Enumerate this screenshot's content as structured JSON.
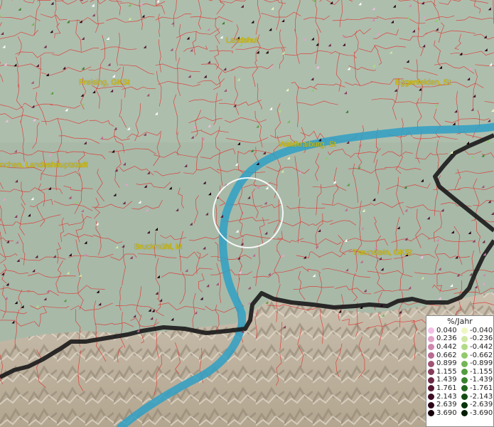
{
  "places": [
    {
      "name": "Landshut"
    },
    {
      "name": "Freising, GKSt"
    },
    {
      "name": "Eggenfelden, St"
    },
    {
      "name": "Waldkraiburg, St"
    },
    {
      "name": "nchen, Landeshauptstadt"
    },
    {
      "name": "Bruckmühl, M"
    },
    {
      "name": "Traunstein, GKSt"
    }
  ],
  "legend": {
    "title": "%/Jahr",
    "positive": [
      {
        "value": "0.040",
        "color": "#f3bfe6"
      },
      {
        "value": "0.236",
        "color": "#e3a3c9"
      },
      {
        "value": "0.442",
        "color": "#cf86ad"
      },
      {
        "value": "0.662",
        "color": "#b96a90"
      },
      {
        "value": "0.899",
        "color": "#a05373"
      },
      {
        "value": "1.155",
        "color": "#873c5b"
      },
      {
        "value": "1.439",
        "color": "#6d2846"
      },
      {
        "value": "1.761",
        "color": "#561734"
      },
      {
        "value": "2.143",
        "color": "#3f0b24"
      },
      {
        "value": "2.639",
        "color": "#2a0416"
      },
      {
        "value": "3.690",
        "color": "#170009"
      }
    ],
    "negative": [
      {
        "value": "-0.040",
        "color": "#eef7c0"
      },
      {
        "value": "-0.236",
        "color": "#cfe9a1"
      },
      {
        "value": "-0.442",
        "color": "#b1db86"
      },
      {
        "value": "-0.662",
        "color": "#93c96c"
      },
      {
        "value": "-0.899",
        "color": "#74b555"
      },
      {
        "value": "-1.155",
        "color": "#559c40"
      },
      {
        "value": "-1.439",
        "color": "#3a812d"
      },
      {
        "value": "-1.761",
        "color": "#23661e"
      },
      {
        "value": "-2.143",
        "color": "#134c12"
      },
      {
        "value": "-2.639",
        "color": "#07330a"
      },
      {
        "value": "-3.690",
        "color": "#021d04"
      }
    ]
  },
  "colors": {
    "boundary": "#e0302a",
    "river": "#2fa0c4",
    "border": "#1a1a1a",
    "selection_ring": "#ffffff"
  }
}
